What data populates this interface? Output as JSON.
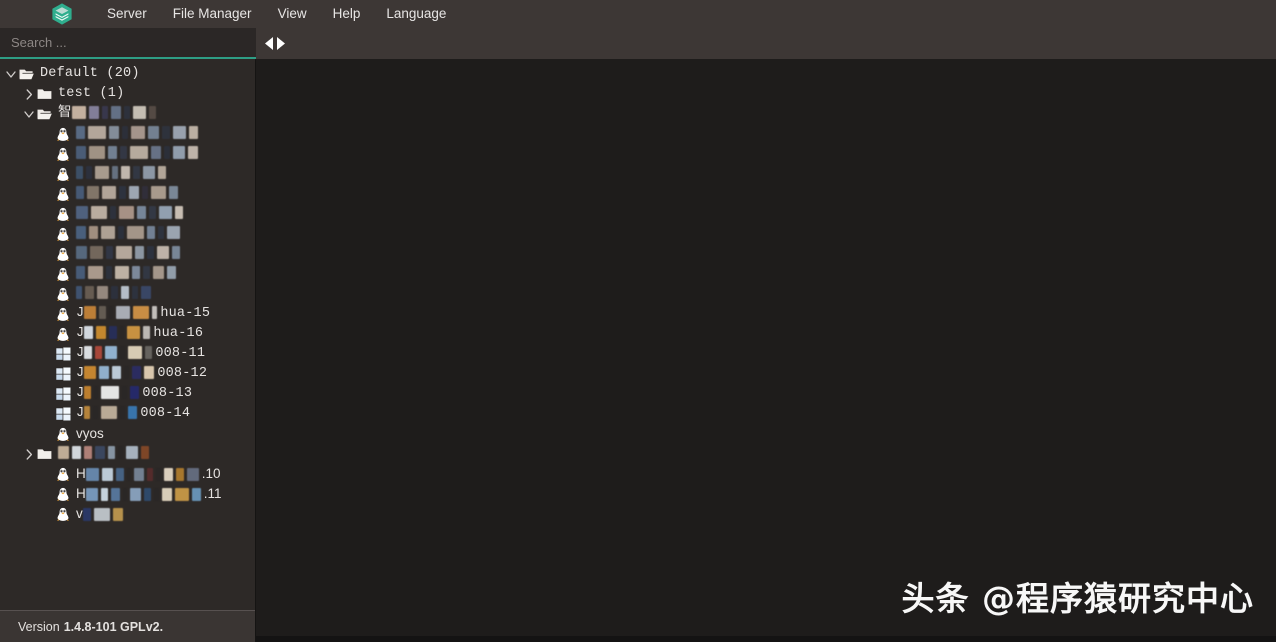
{
  "app": {
    "logo_icon": "stacked-layers-hexagon-logo",
    "accent_color": "#2e9e85",
    "menubar_bg": "#3d3735",
    "sidebar_bg": "#2d2927",
    "panel_bg": "#1e1c1b"
  },
  "menubar": {
    "items": [
      {
        "label": "Server"
      },
      {
        "label": "File Manager"
      },
      {
        "label": "View"
      },
      {
        "label": "Help"
      },
      {
        "label": "Language"
      }
    ]
  },
  "toolbar": {
    "search": {
      "placeholder": "Search ...",
      "value": ""
    },
    "nav_prev_icon": "triangle-left-icon",
    "nav_next_icon": "triangle-right-icon"
  },
  "tree": {
    "rows": [
      {
        "id": "default",
        "indent": 0,
        "twisty": "expanded",
        "icon": "folder-open-icon",
        "label": "Default (20)",
        "font": "mono",
        "redacted": []
      },
      {
        "id": "test",
        "indent": 1,
        "twisty": "collapsed",
        "icon": "folder-closed-icon",
        "label": "test (1)",
        "font": "mono",
        "redacted": []
      },
      {
        "id": "zhi-folder",
        "indent": 1,
        "twisty": "expanded",
        "icon": "folder-open-icon",
        "label": "智",
        "font": "mono",
        "redacted": [
          {
            "w": 14,
            "c": "#d8c3b0"
          },
          {
            "w": 10,
            "c": "#8e8aa8"
          },
          {
            "w": 6,
            "c": "#3a3a52"
          },
          {
            "w": 10,
            "c": "#6b7a92"
          },
          {
            "w": 6,
            "c": "#2e3340"
          },
          {
            "w": 13,
            "c": "#d9d2c6"
          },
          {
            "w": 7,
            "c": "#5a4f48"
          }
        ]
      },
      {
        "id": "host-1",
        "indent": 2,
        "twisty": "none",
        "icon": "linux-penguin-icon",
        "label": "",
        "font": "mono",
        "redacted": [
          {
            "w": 9,
            "c": "#5f7490"
          },
          {
            "w": 18,
            "c": "#c6b8aa"
          },
          {
            "w": 10,
            "c": "#8f9aa8"
          },
          {
            "w": 6,
            "c": "#2c303c"
          },
          {
            "w": 14,
            "c": "#b5a59a"
          },
          {
            "w": 11,
            "c": "#7d8da0"
          },
          {
            "w": 8,
            "c": "#2f3440"
          },
          {
            "w": 13,
            "c": "#a8b2c0"
          },
          {
            "w": 9,
            "c": "#cfc2b4"
          }
        ]
      },
      {
        "id": "host-2",
        "indent": 2,
        "twisty": "none",
        "icon": "linux-penguin-icon",
        "label": "",
        "font": "mono",
        "redacted": [
          {
            "w": 10,
            "c": "#4f6482"
          },
          {
            "w": 16,
            "c": "#b0a191"
          },
          {
            "w": 9,
            "c": "#7c8ca0"
          },
          {
            "w": 7,
            "c": "#343a48"
          },
          {
            "w": 18,
            "c": "#c9bcae"
          },
          {
            "w": 10,
            "c": "#6e7c92"
          },
          {
            "w": 6,
            "c": "#2b303c"
          },
          {
            "w": 12,
            "c": "#9fadbe"
          },
          {
            "w": 10,
            "c": "#d3c7bb"
          }
        ]
      },
      {
        "id": "host-3",
        "indent": 2,
        "twisty": "none",
        "icon": "linux-penguin-icon",
        "label": "",
        "font": "mono",
        "redacted": [
          {
            "w": 7,
            "c": "#3f556f"
          },
          {
            "w": 6,
            "c": "#2c3240"
          },
          {
            "w": 14,
            "c": "#b9ab9d"
          },
          {
            "w": 6,
            "c": "#6d7a8c"
          },
          {
            "w": 9,
            "c": "#d6cbc0"
          },
          {
            "w": 7,
            "c": "#333a47"
          },
          {
            "w": 12,
            "c": "#9aa7b6"
          },
          {
            "w": 8,
            "c": "#c5b7a8"
          }
        ]
      },
      {
        "id": "host-4",
        "indent": 2,
        "twisty": "none",
        "icon": "linux-penguin-icon",
        "label": "",
        "font": "mono",
        "redacted": [
          {
            "w": 8,
            "c": "#4a6080"
          },
          {
            "w": 12,
            "c": "#8d8072"
          },
          {
            "w": 14,
            "c": "#c4b6a8"
          },
          {
            "w": 7,
            "c": "#2e3442"
          },
          {
            "w": 10,
            "c": "#adb8c6"
          },
          {
            "w": 6,
            "c": "#312f3c"
          },
          {
            "w": 15,
            "c": "#b9aa9b"
          },
          {
            "w": 9,
            "c": "#8594a6"
          }
        ]
      },
      {
        "id": "host-5",
        "indent": 2,
        "twisty": "none",
        "icon": "linux-penguin-icon",
        "label": "",
        "font": "mono",
        "redacted": [
          {
            "w": 12,
            "c": "#54698a"
          },
          {
            "w": 16,
            "c": "#cdbfb0"
          },
          {
            "w": 6,
            "c": "#2d3340"
          },
          {
            "w": 15,
            "c": "#b7a092"
          },
          {
            "w": 9,
            "c": "#8192a8"
          },
          {
            "w": 7,
            "c": "#343b48"
          },
          {
            "w": 13,
            "c": "#9fb0c2"
          },
          {
            "w": 8,
            "c": "#ddd2c6"
          }
        ]
      },
      {
        "id": "host-6",
        "indent": 2,
        "twisty": "none",
        "icon": "linux-penguin-icon",
        "label": "",
        "font": "mono",
        "redacted": [
          {
            "w": 10,
            "c": "#4d6788"
          },
          {
            "w": 9,
            "c": "#b09c8c"
          },
          {
            "w": 14,
            "c": "#c0b2a4"
          },
          {
            "w": 6,
            "c": "#2b313e"
          },
          {
            "w": 17,
            "c": "#b4a496"
          },
          {
            "w": 8,
            "c": "#7c8da2"
          },
          {
            "w": 6,
            "c": "#2f3542"
          },
          {
            "w": 13,
            "c": "#aab6c4"
          }
        ]
      },
      {
        "id": "host-7",
        "indent": 2,
        "twisty": "none",
        "icon": "linux-penguin-icon",
        "label": "",
        "font": "mono",
        "redacted": [
          {
            "w": 11,
            "c": "#5c7189"
          },
          {
            "w": 13,
            "c": "#7d7064"
          },
          {
            "w": 7,
            "c": "#323848"
          },
          {
            "w": 16,
            "c": "#c7b9ab"
          },
          {
            "w": 9,
            "c": "#9aa6b4"
          },
          {
            "w": 7,
            "c": "#2e3442"
          },
          {
            "w": 12,
            "c": "#d2c6ba"
          },
          {
            "w": 8,
            "c": "#8393a6"
          }
        ]
      },
      {
        "id": "host-8",
        "indent": 2,
        "twisty": "none",
        "icon": "linux-penguin-icon",
        "label": "",
        "font": "mono",
        "redacted": [
          {
            "w": 9,
            "c": "#4b6383"
          },
          {
            "w": 15,
            "c": "#bba99a"
          },
          {
            "w": 6,
            "c": "#2d3340"
          },
          {
            "w": 14,
            "c": "#d1c4b6"
          },
          {
            "w": 8,
            "c": "#8796aa"
          },
          {
            "w": 7,
            "c": "#333947"
          },
          {
            "w": 11,
            "c": "#b5a698"
          },
          {
            "w": 9,
            "c": "#9fadbc"
          }
        ]
      },
      {
        "id": "host-9",
        "indent": 2,
        "twisty": "none",
        "icon": "linux-penguin-icon",
        "label": "",
        "font": "mono",
        "redacted": [
          {
            "w": 6,
            "c": "#42587a"
          },
          {
            "w": 9,
            "c": "#6e6257"
          },
          {
            "w": 11,
            "c": "#a4968a"
          },
          {
            "w": 7,
            "c": "#2c3240"
          },
          {
            "w": 8,
            "c": "#c8d2de"
          },
          {
            "w": 6,
            "c": "#2e3442"
          },
          {
            "w": 10,
            "c": "#3b4b6e"
          }
        ]
      },
      {
        "id": "hua-15",
        "indent": 2,
        "twisty": "none",
        "icon": "linux-penguin-icon",
        "label_prefix": "J",
        "label_suffix": "hua-15",
        "font": "mono",
        "redacted": [
          {
            "w": 12,
            "c": "#d08a3a"
          },
          {
            "w": 7,
            "c": "#6b6258"
          },
          {
            "w": 4,
            "c": "#2a2726"
          },
          {
            "w": 14,
            "c": "#b9bfc8"
          },
          {
            "w": 16,
            "c": "#de9b48"
          },
          {
            "w": 5,
            "c": "#d7d3cf"
          }
        ]
      },
      {
        "id": "hua-16",
        "indent": 2,
        "twisty": "none",
        "icon": "linux-penguin-icon",
        "label_prefix": "J",
        "label_suffix": "hua-16",
        "font": "mono",
        "redacted": [
          {
            "w": 9,
            "c": "#e8f0f8"
          },
          {
            "w": 10,
            "c": "#d8952f"
          },
          {
            "w": 8,
            "c": "#272f5e"
          },
          {
            "w": 4,
            "c": "#2a2726"
          },
          {
            "w": 13,
            "c": "#dda045"
          },
          {
            "w": 7,
            "c": "#cfcbc7"
          }
        ]
      },
      {
        "id": "win-008-11",
        "indent": 2,
        "twisty": "none",
        "icon": "windows-logo-icon",
        "label_prefix": "J",
        "label_suffix": "008-11",
        "font": "mono",
        "redacted": [
          {
            "w": 8,
            "c": "#f2f6fa"
          },
          {
            "w": 7,
            "c": "#b84a3c"
          },
          {
            "w": 12,
            "c": "#9fc4e4"
          },
          {
            "w": 5,
            "c": "#2a2726"
          },
          {
            "w": 14,
            "c": "#efe2c8"
          },
          {
            "w": 7,
            "c": "#6d6a66"
          }
        ]
      },
      {
        "id": "win-008-12",
        "indent": 2,
        "twisty": "none",
        "icon": "windows-logo-icon",
        "label_prefix": "J",
        "label_suffix": "008-12",
        "font": "mono",
        "redacted": [
          {
            "w": 12,
            "c": "#d99232"
          },
          {
            "w": 10,
            "c": "#9ec2e2"
          },
          {
            "w": 9,
            "c": "#cfe0ef"
          },
          {
            "w": 5,
            "c": "#2a2726"
          },
          {
            "w": 9,
            "c": "#2b2d68"
          },
          {
            "w": 10,
            "c": "#f0dcc0"
          }
        ]
      },
      {
        "id": "win-008-13",
        "indent": 2,
        "twisty": "none",
        "icon": "windows-logo-icon",
        "label_prefix": "J",
        "label_suffix": "008-13",
        "font": "mono",
        "redacted": [
          {
            "w": 7,
            "c": "#d08a30"
          },
          {
            "w": 4,
            "c": "#2a2726"
          },
          {
            "w": 18,
            "c": "#fefefe"
          },
          {
            "w": 5,
            "c": "#2a2726"
          },
          {
            "w": 9,
            "c": "#252a72"
          }
        ]
      },
      {
        "id": "win-008-14",
        "indent": 2,
        "twisty": "none",
        "icon": "windows-logo-icon",
        "label_prefix": "J",
        "label_suffix": "008-14",
        "font": "mono",
        "redacted": [
          {
            "w": 6,
            "c": "#c8903e"
          },
          {
            "w": 5,
            "c": "#2a2726"
          },
          {
            "w": 16,
            "c": "#cdbca6"
          },
          {
            "w": 5,
            "c": "#2a2726"
          },
          {
            "w": 9,
            "c": "#3a7fbe"
          }
        ]
      },
      {
        "id": "vyos",
        "indent": 2,
        "twisty": "none",
        "icon": "linux-penguin-icon",
        "label": "vyos",
        "font": "sans",
        "redacted": []
      },
      {
        "id": "env-folder",
        "indent": 1,
        "twisty": "collapsed",
        "icon": "folder-closed-icon",
        "label": "",
        "font": "mono",
        "redacted": [
          {
            "w": 11,
            "c": "#d2bfa6"
          },
          {
            "w": 9,
            "c": "#e8eef4"
          },
          {
            "w": 8,
            "c": "#c08b82"
          },
          {
            "w": 10,
            "c": "#3c4a66"
          },
          {
            "w": 7,
            "c": "#93a3b4"
          },
          {
            "w": 5,
            "c": "#2a2726"
          },
          {
            "w": 12,
            "c": "#b7c4d2"
          },
          {
            "w": 8,
            "c": "#8a4a28"
          }
        ]
      },
      {
        "id": "h-10",
        "indent": 2,
        "twisty": "none",
        "icon": "linux-penguin-icon",
        "label_prefix": "H",
        "label_suffix": ".10",
        "font": "sans",
        "redacted": [
          {
            "w": 13,
            "c": "#6d92bc"
          },
          {
            "w": 11,
            "c": "#cfe0ee"
          },
          {
            "w": 8,
            "c": "#4a6a90"
          },
          {
            "w": 4,
            "c": "#2a2726"
          },
          {
            "w": 10,
            "c": "#7d8ca0"
          },
          {
            "w": 6,
            "c": "#5a2c2c"
          },
          {
            "w": 5,
            "c": "#2a2726"
          },
          {
            "w": 9,
            "c": "#f2e6d2"
          },
          {
            "w": 8,
            "c": "#b8822e"
          },
          {
            "w": 12,
            "c": "#6a7488"
          }
        ]
      },
      {
        "id": "h-11",
        "indent": 2,
        "twisty": "none",
        "icon": "linux-penguin-icon",
        "label_prefix": "H",
        "label_suffix": ".11",
        "font": "sans",
        "redacted": [
          {
            "w": 12,
            "c": "#7fa4cc"
          },
          {
            "w": 7,
            "c": "#dceaf6"
          },
          {
            "w": 9,
            "c": "#5b7fa8"
          },
          {
            "w": 4,
            "c": "#2a2726"
          },
          {
            "w": 11,
            "c": "#92aecc"
          },
          {
            "w": 7,
            "c": "#2f4e74"
          },
          {
            "w": 5,
            "c": "#2a2726"
          },
          {
            "w": 10,
            "c": "#f0e4cc"
          },
          {
            "w": 14,
            "c": "#d4a24a"
          },
          {
            "w": 9,
            "c": "#6ea0c8"
          }
        ]
      },
      {
        "id": "v-last",
        "indent": 2,
        "twisty": "none",
        "icon": "linux-penguin-icon",
        "label_prefix": "v",
        "label_suffix": "",
        "font": "sans",
        "redacted": [
          {
            "w": 8,
            "c": "#2a3a6e"
          },
          {
            "w": 16,
            "c": "#cdd4da"
          },
          {
            "w": 10,
            "c": "#c9a052"
          }
        ]
      }
    ]
  },
  "statusbar": {
    "version_label": "Version",
    "version_value": "1.4.8-101 GPLv2."
  },
  "watermark": {
    "text": "头条 @程序猿研究中心"
  }
}
